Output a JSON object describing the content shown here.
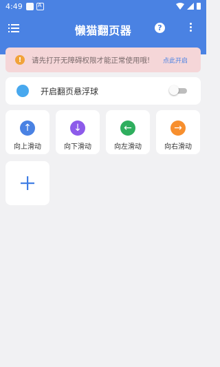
{
  "status_bar": {
    "time": "4:49"
  },
  "app_bar": {
    "title": "懒猫翻页器",
    "help_icon_glyph": "?"
  },
  "notice": {
    "icon_glyph": "!",
    "text": "请先打开无障碍权限才能正常使用哦!",
    "link": "点此开启"
  },
  "float_ball": {
    "label": "开启翻页悬浮球",
    "enabled": false
  },
  "actions": [
    {
      "label": "向上滑动",
      "icon": "arrow-up-icon",
      "glyph": "↑",
      "color": "#4a82e3"
    },
    {
      "label": "向下滑动",
      "icon": "arrow-down-icon",
      "glyph": "↓",
      "color": "#8d5bea"
    },
    {
      "label": "向左滑动",
      "icon": "arrow-left-icon",
      "glyph": "←",
      "color": "#2fae5e"
    },
    {
      "label": "向右滑动",
      "icon": "arrow-right-icon",
      "glyph": "→",
      "color": "#f78f2e"
    }
  ],
  "add_action": {
    "icon": "plus-icon"
  },
  "colors": {
    "accent": "#4a82e3",
    "notice_bg": "#f5d6d8",
    "warning": "#f1a33a",
    "float_dot": "#48a8ee",
    "page_bg": "#f1f1f3"
  }
}
